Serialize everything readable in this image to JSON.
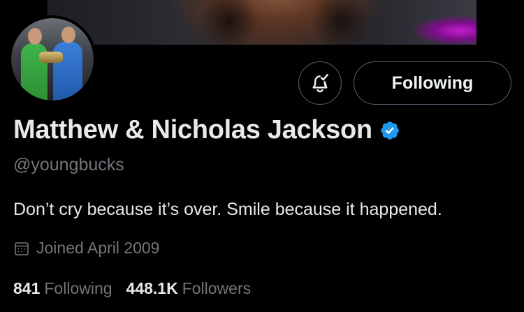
{
  "profile": {
    "display_name": "Matthew & Nicholas Jackson",
    "handle": "@youngbucks",
    "bio": "Don’t cry because it’s over. Smile because it happened.",
    "joined": "Joined April 2009",
    "verified_color": "#1d9bf0"
  },
  "actions": {
    "notifications_icon": "bell-check-icon",
    "following_label": "Following"
  },
  "stats": {
    "following_count": "841",
    "following_label": "Following",
    "followers_count": "448.1K",
    "followers_label": "Followers"
  },
  "theme": {
    "background": "#000000",
    "text_primary": "#e7e9ea",
    "text_secondary": "#71767b",
    "border": "#536471"
  }
}
